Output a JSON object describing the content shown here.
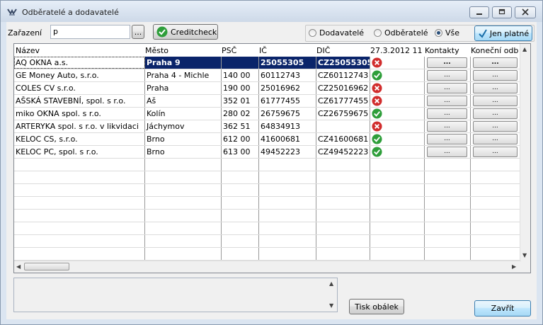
{
  "window": {
    "title": "Odběratelé a dodavatelé"
  },
  "filter": {
    "label": "Zařazení",
    "value": "p",
    "browse_label": "...",
    "creditcheck_label": "Creditcheck"
  },
  "radios": {
    "dodavatele": "Dodavatelé",
    "odberatele": "Odběratelé",
    "vse": "Vše",
    "selected": "vse"
  },
  "jen_platne_label": "Jen platné",
  "table": {
    "columns": [
      "Název",
      "Město",
      "PSČ",
      "IČ",
      "DIČ",
      "27.3.2012 11:",
      "Kontakty",
      "Koneční odb"
    ],
    "button_label": "...",
    "rows": [
      {
        "nazev": "AQ OKNA a.s.",
        "mesto": "Praha 9",
        "psc": "",
        "ic": "25055305",
        "dic": "CZ25055305",
        "status": "bad",
        "selected": true
      },
      {
        "nazev": "GE Money Auto, s.r.o.",
        "mesto": "Praha 4 - Michle",
        "psc": "140 00",
        "ic": "60112743",
        "dic": "CZ60112743",
        "status": "ok"
      },
      {
        "nazev": "COLES CV s.r.o.",
        "mesto": "Praha",
        "psc": "190 00",
        "ic": "25016962",
        "dic": "CZ25016962",
        "status": "bad"
      },
      {
        "nazev": "AŠSKÁ STAVEBNÍ, spol. s r.o.",
        "mesto": "Aš",
        "psc": "352 01",
        "ic": "61777455",
        "dic": "CZ61777455",
        "status": "bad"
      },
      {
        "nazev": "miko OKNA spol. s r.o.",
        "mesto": "Kolín",
        "psc": "280 02",
        "ic": "26759675",
        "dic": "CZ26759675",
        "status": "ok"
      },
      {
        "nazev": "ARTERYKA spol. s r.o. v likvidaci",
        "mesto": "Jáchymov",
        "psc": "362 51",
        "ic": "64834913",
        "dic": "",
        "status": "bad"
      },
      {
        "nazev": "KELOC CS, s.r.o.",
        "mesto": "Brno",
        "psc": "612 00",
        "ic": "41600681",
        "dic": "CZ41600681",
        "status": "ok"
      },
      {
        "nazev": "KELOC PC, spol. s r.o.",
        "mesto": "Brno",
        "psc": "613 00",
        "ic": "49452223",
        "dic": "CZ49452223",
        "status": "ok"
      }
    ]
  },
  "colors": {
    "selected_row": "#0a246a",
    "ok": "#2e9e3a",
    "bad": "#d12d2d"
  },
  "footer": {
    "tisk_label": "Tisk obálek",
    "zavrit_label": "Zavřít"
  }
}
